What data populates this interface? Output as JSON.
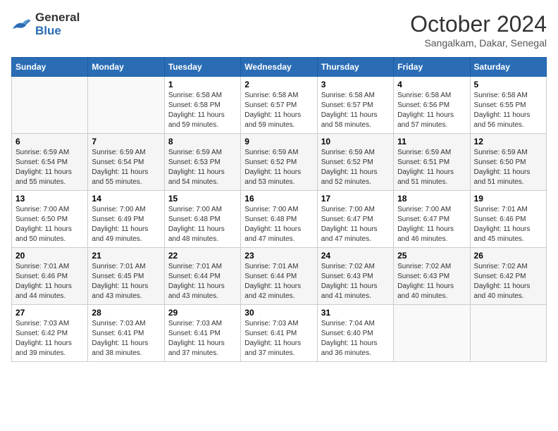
{
  "header": {
    "logo_general": "General",
    "logo_blue": "Blue",
    "month_title": "October 2024",
    "location": "Sangalkam, Dakar, Senegal"
  },
  "calendar": {
    "days_of_week": [
      "Sunday",
      "Monday",
      "Tuesday",
      "Wednesday",
      "Thursday",
      "Friday",
      "Saturday"
    ],
    "weeks": [
      [
        {
          "day": "",
          "info": ""
        },
        {
          "day": "",
          "info": ""
        },
        {
          "day": "1",
          "info": "Sunrise: 6:58 AM\nSunset: 6:58 PM\nDaylight: 11 hours and 59 minutes."
        },
        {
          "day": "2",
          "info": "Sunrise: 6:58 AM\nSunset: 6:57 PM\nDaylight: 11 hours and 59 minutes."
        },
        {
          "day": "3",
          "info": "Sunrise: 6:58 AM\nSunset: 6:57 PM\nDaylight: 11 hours and 58 minutes."
        },
        {
          "day": "4",
          "info": "Sunrise: 6:58 AM\nSunset: 6:56 PM\nDaylight: 11 hours and 57 minutes."
        },
        {
          "day": "5",
          "info": "Sunrise: 6:58 AM\nSunset: 6:55 PM\nDaylight: 11 hours and 56 minutes."
        }
      ],
      [
        {
          "day": "6",
          "info": "Sunrise: 6:59 AM\nSunset: 6:54 PM\nDaylight: 11 hours and 55 minutes."
        },
        {
          "day": "7",
          "info": "Sunrise: 6:59 AM\nSunset: 6:54 PM\nDaylight: 11 hours and 55 minutes."
        },
        {
          "day": "8",
          "info": "Sunrise: 6:59 AM\nSunset: 6:53 PM\nDaylight: 11 hours and 54 minutes."
        },
        {
          "day": "9",
          "info": "Sunrise: 6:59 AM\nSunset: 6:52 PM\nDaylight: 11 hours and 53 minutes."
        },
        {
          "day": "10",
          "info": "Sunrise: 6:59 AM\nSunset: 6:52 PM\nDaylight: 11 hours and 52 minutes."
        },
        {
          "day": "11",
          "info": "Sunrise: 6:59 AM\nSunset: 6:51 PM\nDaylight: 11 hours and 51 minutes."
        },
        {
          "day": "12",
          "info": "Sunrise: 6:59 AM\nSunset: 6:50 PM\nDaylight: 11 hours and 51 minutes."
        }
      ],
      [
        {
          "day": "13",
          "info": "Sunrise: 7:00 AM\nSunset: 6:50 PM\nDaylight: 11 hours and 50 minutes."
        },
        {
          "day": "14",
          "info": "Sunrise: 7:00 AM\nSunset: 6:49 PM\nDaylight: 11 hours and 49 minutes."
        },
        {
          "day": "15",
          "info": "Sunrise: 7:00 AM\nSunset: 6:48 PM\nDaylight: 11 hours and 48 minutes."
        },
        {
          "day": "16",
          "info": "Sunrise: 7:00 AM\nSunset: 6:48 PM\nDaylight: 11 hours and 47 minutes."
        },
        {
          "day": "17",
          "info": "Sunrise: 7:00 AM\nSunset: 6:47 PM\nDaylight: 11 hours and 47 minutes."
        },
        {
          "day": "18",
          "info": "Sunrise: 7:00 AM\nSunset: 6:47 PM\nDaylight: 11 hours and 46 minutes."
        },
        {
          "day": "19",
          "info": "Sunrise: 7:01 AM\nSunset: 6:46 PM\nDaylight: 11 hours and 45 minutes."
        }
      ],
      [
        {
          "day": "20",
          "info": "Sunrise: 7:01 AM\nSunset: 6:46 PM\nDaylight: 11 hours and 44 minutes."
        },
        {
          "day": "21",
          "info": "Sunrise: 7:01 AM\nSunset: 6:45 PM\nDaylight: 11 hours and 43 minutes."
        },
        {
          "day": "22",
          "info": "Sunrise: 7:01 AM\nSunset: 6:44 PM\nDaylight: 11 hours and 43 minutes."
        },
        {
          "day": "23",
          "info": "Sunrise: 7:01 AM\nSunset: 6:44 PM\nDaylight: 11 hours and 42 minutes."
        },
        {
          "day": "24",
          "info": "Sunrise: 7:02 AM\nSunset: 6:43 PM\nDaylight: 11 hours and 41 minutes."
        },
        {
          "day": "25",
          "info": "Sunrise: 7:02 AM\nSunset: 6:43 PM\nDaylight: 11 hours and 40 minutes."
        },
        {
          "day": "26",
          "info": "Sunrise: 7:02 AM\nSunset: 6:42 PM\nDaylight: 11 hours and 40 minutes."
        }
      ],
      [
        {
          "day": "27",
          "info": "Sunrise: 7:03 AM\nSunset: 6:42 PM\nDaylight: 11 hours and 39 minutes."
        },
        {
          "day": "28",
          "info": "Sunrise: 7:03 AM\nSunset: 6:41 PM\nDaylight: 11 hours and 38 minutes."
        },
        {
          "day": "29",
          "info": "Sunrise: 7:03 AM\nSunset: 6:41 PM\nDaylight: 11 hours and 37 minutes."
        },
        {
          "day": "30",
          "info": "Sunrise: 7:03 AM\nSunset: 6:41 PM\nDaylight: 11 hours and 37 minutes."
        },
        {
          "day": "31",
          "info": "Sunrise: 7:04 AM\nSunset: 6:40 PM\nDaylight: 11 hours and 36 minutes."
        },
        {
          "day": "",
          "info": ""
        },
        {
          "day": "",
          "info": ""
        }
      ]
    ]
  }
}
